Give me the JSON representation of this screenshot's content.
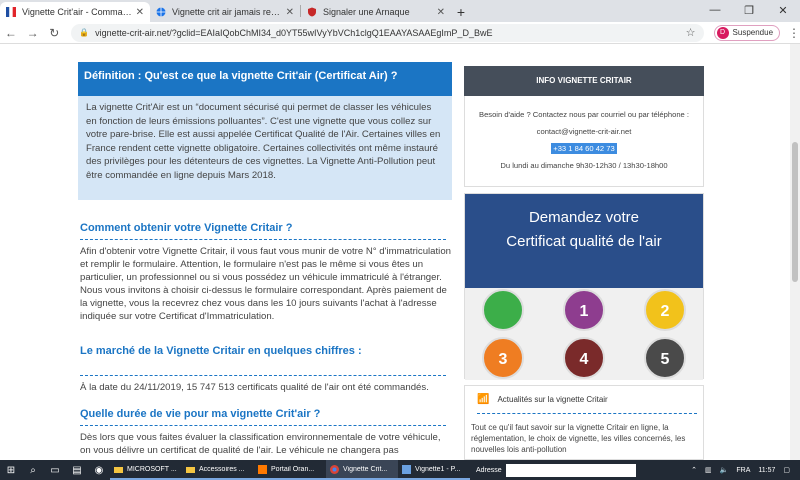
{
  "tabs": [
    {
      "label": "Vignette Crit'air - Commandez vo",
      "active": true,
      "favicon": "flag-fr-icon"
    },
    {
      "label": "Vignette crit air jamais reçue ma",
      "active": false,
      "favicon": "globe-icon"
    },
    {
      "label": "Signaler une Arnaque",
      "active": false,
      "favicon": "shield-icon"
    }
  ],
  "window_controls": {
    "minimize": "—",
    "maximize": "❐",
    "close": "✕"
  },
  "toolbar": {
    "url": "vignette-crit-air.net/?gclid=EAIaIQobChMI34_d0YT55wIVyYbVCh1clgQ1EAAYASAAEgImP_D_BwE",
    "profile_initial": "D",
    "profile_label": "Suspendue"
  },
  "definition": {
    "title": "Définition : Qu'est ce que la vignette Crit'air (Certificat Air) ?",
    "body": "La vignette Crit'Air est un “document sécurisé qui permet de classer les véhicules en fonction de leurs émissions polluantes”. C'est une vignette que vous collez sur votre pare-brise. Elle est aussi appelée Certificat Qualité de l'Air. Certaines villes en France rendent cette vignette obligatoire. Certaines collectivités ont même instauré des privilèges pour les détenteurs de ces vignettes. La Vignette Anti-Pollution peut être commandée en ligne depuis Mars 2018."
  },
  "sections": [
    {
      "heading": "Comment obtenir votre Vignette Critair ?",
      "text": "Afin d'obtenir votre Vignette Critair, il vous faut vous munir de votre N° d'immatriculation et remplir le formulaire. Attention, le formulaire n'est pas le même si vous êtes un particulier, un professionnel ou si vous possédez un véhicule immatriculé à l'étranger. Nous vous invitons à choisir ci-dessus le formulaire correspondant. Après paiement de la vignette, vous la recevrez chez vous dans les 10 jours suivants l'achat à l'adresse indiquée sur votre Certificat d'Immatriculation."
    },
    {
      "heading": "Le marché de la Vignette Critair en quelques chiffres :",
      "text": "À la date du 24/11/2019, 15 747 513 certificats qualité de l'air ont été commandés."
    },
    {
      "heading": "Quelle durée de vie pour ma vignette Crit'air ?",
      "text": "Dès lors que vous faites évaluer la classification environnementale de votre véhicule, on vous délivre un certificat de qualité de l'air. Le véhicule ne changera pas"
    }
  ],
  "info": {
    "title": "INFO VIGNETTE CRITAIR",
    "help": "Besoin d'aide ? Contactez nous par courriel ou par téléphone :",
    "email": "contact@vignette-crit-air.net",
    "phone": "+33 1 84 60 42 73",
    "hours": "Du lundi au dimanche 9h30-12h30 / 13h30-18h00"
  },
  "banner": {
    "line1": "Demandez votre",
    "line2": "Certificat qualité de l'air",
    "stickers": [
      {
        "label": "",
        "color": "#3cae49"
      },
      {
        "label": "1",
        "color": "#8e3d8f"
      },
      {
        "label": "2",
        "color": "#f2c21b"
      },
      {
        "label": "3",
        "color": "#ef7d22"
      },
      {
        "label": "4",
        "color": "#7a2a2a"
      },
      {
        "label": "5",
        "color": "#4a4a4a"
      }
    ]
  },
  "actualites": {
    "title": "Actualités sur la vignette Critair",
    "text": "Tout ce qu'il faut savoir sur la vignette Critair en ligne, la réglementation, le choix de vignette, les villes concernés, les nouvelles lois anti-pollution"
  },
  "taskbar": {
    "apps": [
      {
        "label": "MICROSOFT ...",
        "favicon": "folder-icon"
      },
      {
        "label": "Accessoires ...",
        "favicon": "folder-icon"
      },
      {
        "label": "Portail Oran...",
        "favicon": "orange-icon"
      },
      {
        "label": "Vignette Crit...",
        "favicon": "chrome-icon"
      },
      {
        "label": "Vignette1 - P...",
        "favicon": "paint-icon"
      }
    ],
    "address_label": "Adresse",
    "language": "FRA",
    "time": "11:57"
  }
}
